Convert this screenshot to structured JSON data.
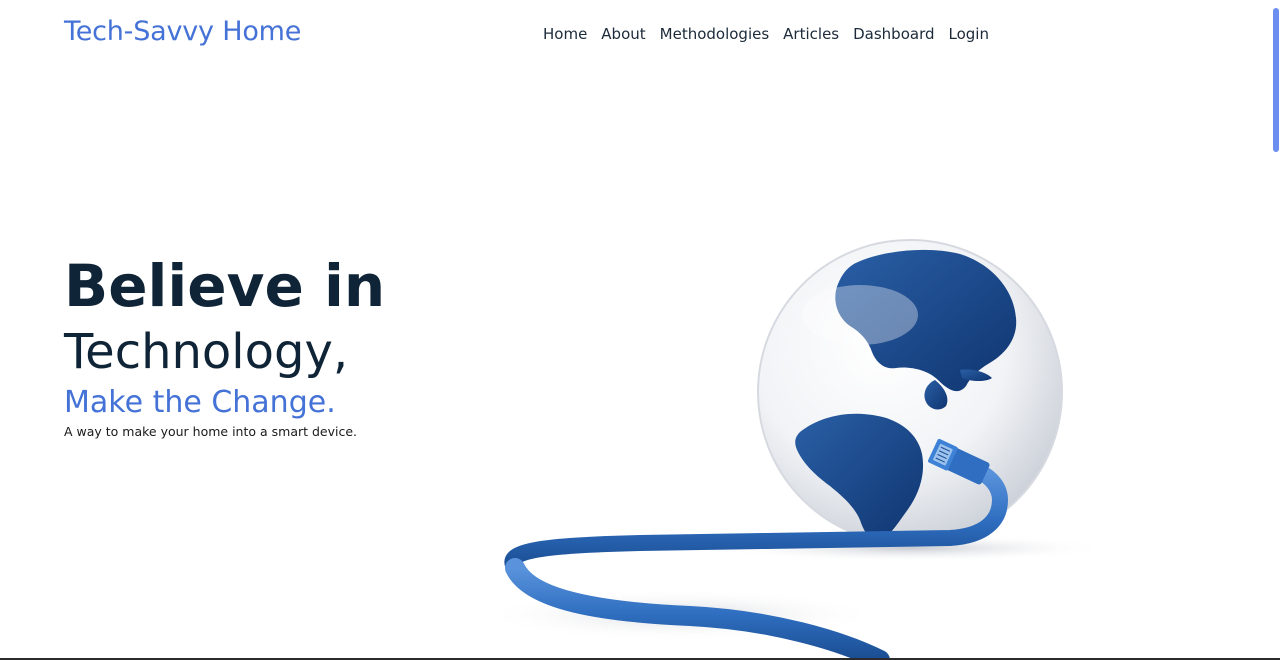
{
  "header": {
    "brand": "Tech-Savvy Home",
    "nav": [
      "Home",
      "About",
      "Methodologies",
      "Articles",
      "Dashboard",
      "Login"
    ]
  },
  "hero": {
    "line1": "Believe in",
    "line2": "Technology,",
    "line3": "Make the Change.",
    "tagline": "A way to make your home into a smart device."
  },
  "colors": {
    "brand": "#4472d6",
    "heading": "#0f2436",
    "globe_blue": "#1d4a8c",
    "cable_blue": "#2f6ec0",
    "scroll_thumb": "#6b8ef0"
  },
  "icons": {
    "hero_image": "globe-with-network-cable"
  }
}
